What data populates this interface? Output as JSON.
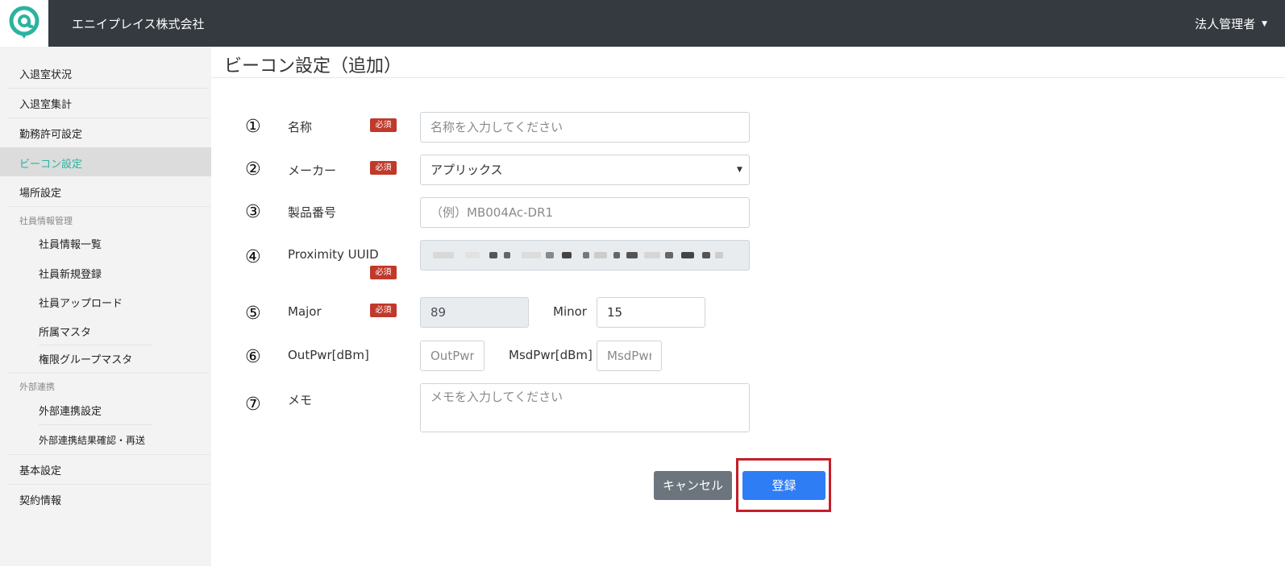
{
  "header": {
    "company_name": "エニイプレイス株式会社",
    "user_menu": "法人管理者",
    "logo_icon": "at-sign-logo-icon",
    "brand_color": "#2bb3a0"
  },
  "sidebar": {
    "items": [
      {
        "label": "入退室状況"
      },
      {
        "label": "入退室集計"
      },
      {
        "label": "勤務許可設定"
      },
      {
        "label": "ビーコン設定",
        "active": true
      },
      {
        "label": "場所設定"
      }
    ],
    "section_employee": "社員情報管理",
    "employee_items": [
      {
        "label": "社員情報一覧"
      },
      {
        "label": "社員新規登録"
      },
      {
        "label": "社員アップロード"
      },
      {
        "label": "所属マスタ"
      },
      {
        "label": "権限グループマスタ"
      }
    ],
    "section_external": "外部連携",
    "external_items": [
      {
        "label": "外部連携設定"
      },
      {
        "label": "外部連携結果確認・再送"
      }
    ],
    "bottom_items": [
      {
        "label": "基本設定"
      },
      {
        "label": "契約情報"
      }
    ],
    "active_color": "#2bb3a0"
  },
  "page": {
    "title": "ビーコン設定（追加）"
  },
  "form": {
    "required_badge": "必須",
    "name": {
      "num": "①",
      "label": "名称",
      "placeholder": "名称を入力してください"
    },
    "maker": {
      "num": "②",
      "label": "メーカー",
      "value": "アプリックス",
      "arrow": "▼"
    },
    "product_no": {
      "num": "③",
      "label": "製品番号",
      "placeholder": "（例）MB004Ac-DR1"
    },
    "uuid": {
      "num": "④",
      "label": "Proximity UUID"
    },
    "major": {
      "num": "⑤",
      "label": "Major",
      "value": "89"
    },
    "minor": {
      "label": "Minor",
      "value": "15"
    },
    "outpwr": {
      "num": "⑥",
      "label": "OutPwr[dBm]",
      "placeholder": "OutPwr"
    },
    "msdpwr": {
      "label": "MsdPwr[dBm]",
      "placeholder": "MsdPwr"
    },
    "memo": {
      "num": "⑦",
      "label": "メモ",
      "placeholder": "メモを入力してください"
    }
  },
  "buttons": {
    "cancel": "キャンセル",
    "submit": "登録"
  },
  "colors": {
    "header_bg": "#343a40",
    "badge": "#c0392b",
    "submit": "#2f7df5",
    "cancel": "#6c757d",
    "highlight": "#c41e2a"
  }
}
